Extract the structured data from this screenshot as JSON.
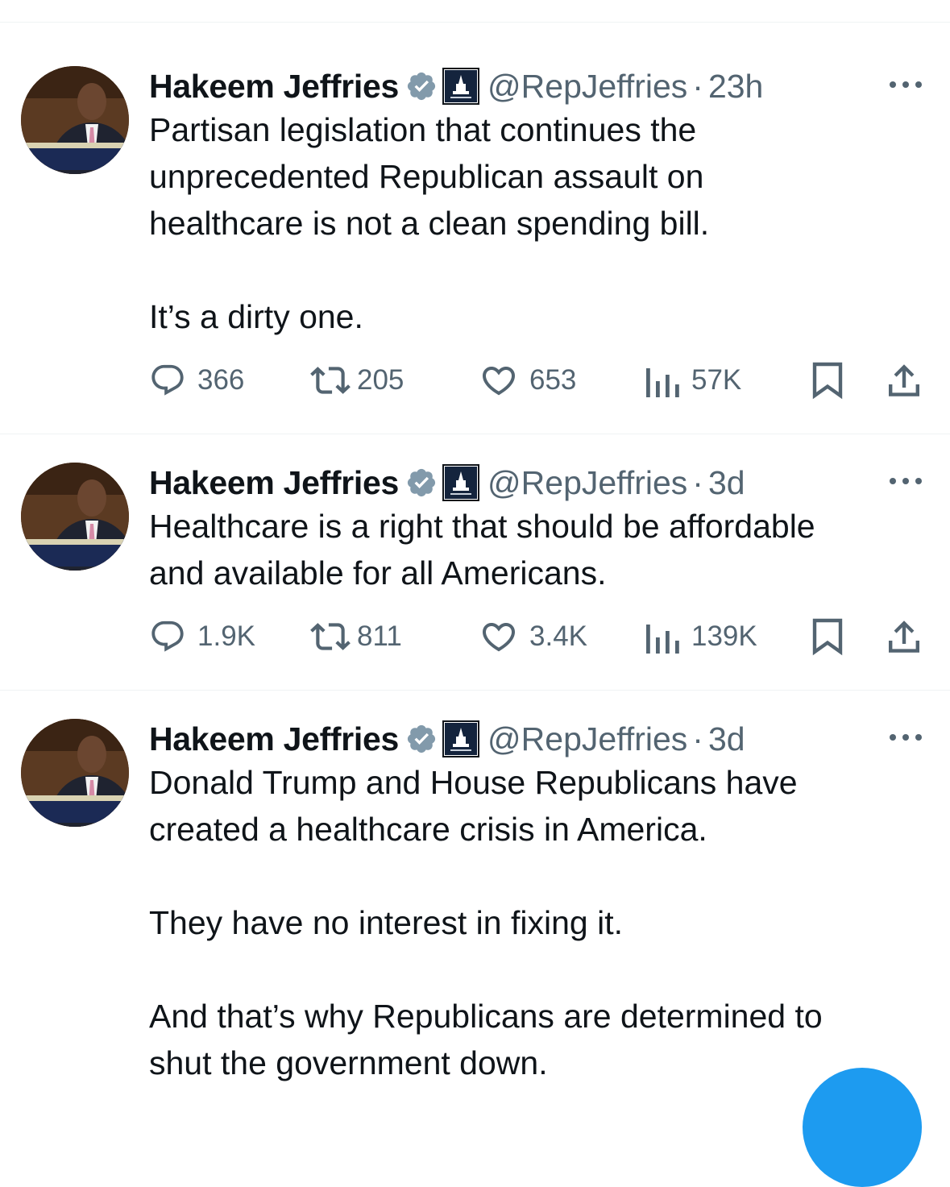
{
  "colors": {
    "text_primary": "#0f1419",
    "text_secondary": "#536471",
    "verified_badge": "#829aab",
    "accent": "#1d9bf0",
    "divider": "#eff3f4"
  },
  "tweets": [
    {
      "author": {
        "name": "Hakeem Jeffries",
        "handle": "@RepJeffries",
        "avatar_icon": "profile-photo",
        "badge_icon": "verified-badge-icon",
        "affiliation_icon": "capitol-affiliation-icon"
      },
      "separator": "·",
      "time": "23h",
      "text": "Partisan legislation that continues the\nunprecedented Republican assault on\nhealthcare is not a clean spending bill.\n\nIt’s a dirty one.",
      "stats": {
        "replies": "366",
        "reposts": "205",
        "likes": "653",
        "views": "57K"
      }
    },
    {
      "author": {
        "name": "Hakeem Jeffries",
        "handle": "@RepJeffries",
        "avatar_icon": "profile-photo",
        "badge_icon": "verified-badge-icon",
        "affiliation_icon": "capitol-affiliation-icon"
      },
      "separator": "·",
      "time": "3d",
      "text": "Healthcare is a right that should be affordable\nand available for all Americans.",
      "stats": {
        "replies": "1.9K",
        "reposts": "811",
        "likes": "3.4K",
        "views": "139K"
      }
    },
    {
      "author": {
        "name": "Hakeem Jeffries",
        "handle": "@RepJeffries",
        "avatar_icon": "profile-photo",
        "badge_icon": "verified-badge-icon",
        "affiliation_icon": "capitol-affiliation-icon"
      },
      "separator": "·",
      "time": "3d",
      "text": "Donald Trump and House Republicans have\ncreated a healthcare crisis in America.\n\nThey have no interest in fixing it.\n\nAnd that’s why Republicans are determined to\nshut the government down.",
      "stats": null
    }
  ],
  "fab": {
    "icon": "compose-icon"
  }
}
